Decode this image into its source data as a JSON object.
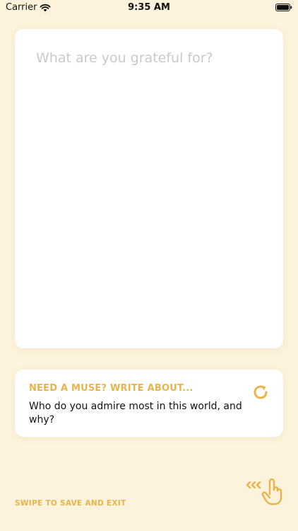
{
  "status_bar": {
    "carrier": "Carrier",
    "time": "9:35 AM",
    "wifi_icon": "wifi-icon",
    "battery_icon": "battery-icon"
  },
  "entry": {
    "placeholder": "What are you grateful for?",
    "value": ""
  },
  "muse": {
    "title": "NEED A MUSE? WRITE ABOUT...",
    "prompt": "Who do you admire most in this world, and why?",
    "refresh_icon": "refresh-icon"
  },
  "footer": {
    "swipe_hint": "SWIPE TO SAVE AND EXIT",
    "gesture_icon": "swipe-hand-icon"
  },
  "colors": {
    "background": "#fdf3dc",
    "accent": "#e8b44a",
    "card": "#ffffff",
    "placeholder": "#c8c9cc"
  }
}
